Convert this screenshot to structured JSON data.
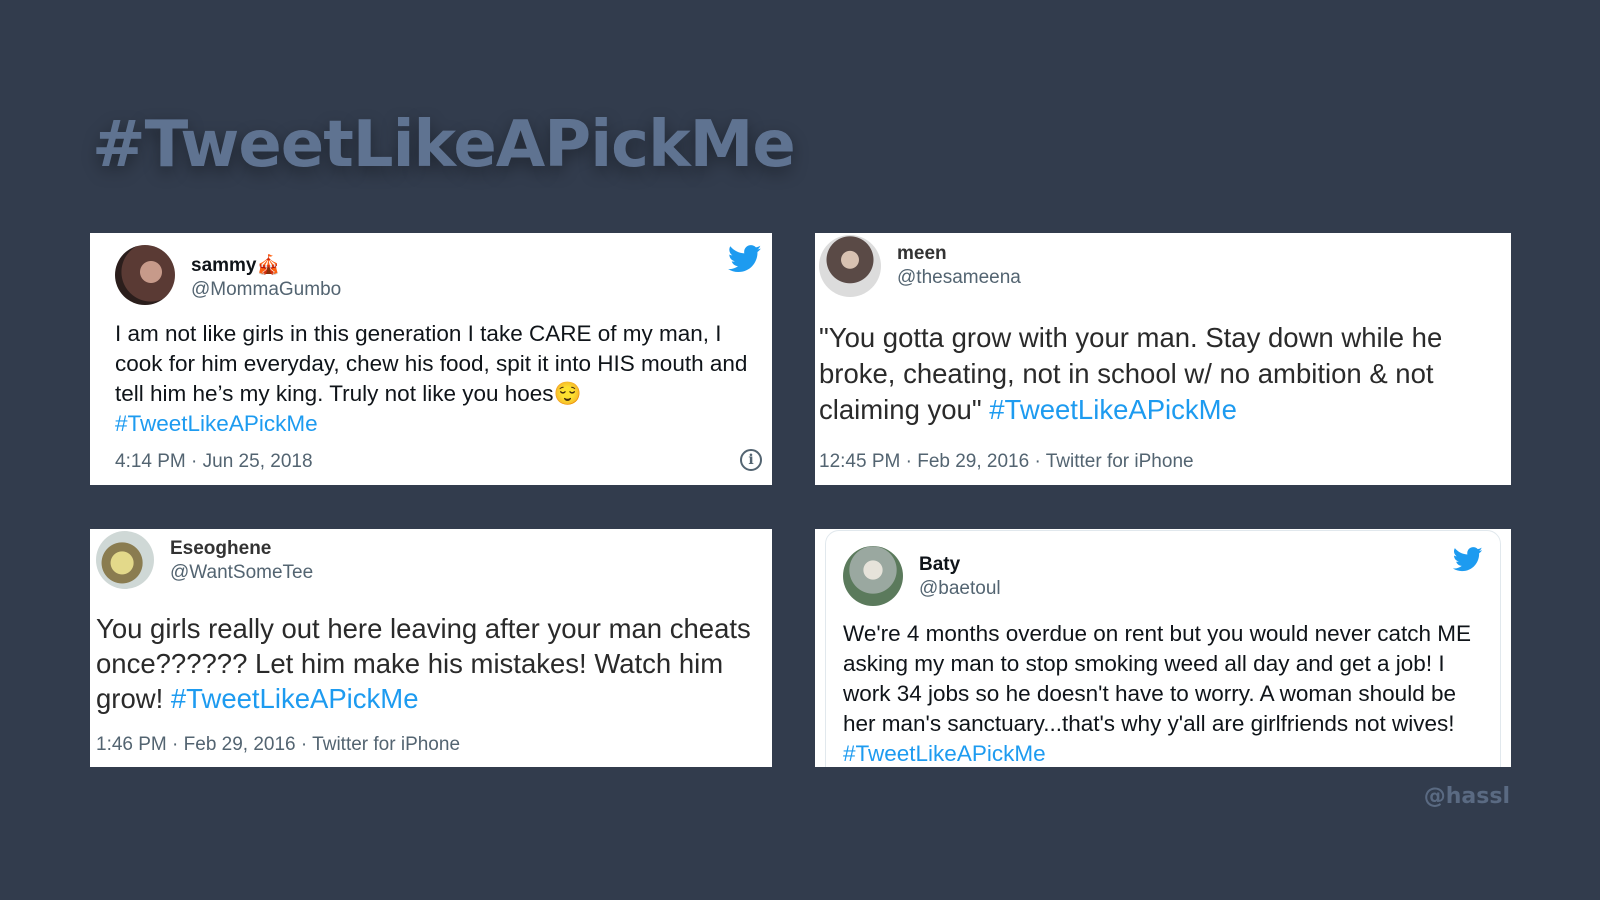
{
  "title": "#TweetLikeAPickMe",
  "watermark": "@hassl",
  "colors": {
    "background": "#323c4d",
    "title": "#5f7391",
    "hashtag": "#1d9bf0"
  },
  "tweets": [
    {
      "display_name": "sammy",
      "name_emoji": "🎪",
      "handle": "@MommaGumbo",
      "text": "I am not like girls in this generation I take CARE of my man, I cook for him everyday, chew his food, spit it into HIS mouth and tell him he’s my king. Truly not like you hoes😌",
      "hashtag": "#TweetLikeAPickMe",
      "meta": "4:14 PM · Jun 25, 2018",
      "icons": [
        "twitter-bird-icon",
        "info-icon"
      ]
    },
    {
      "display_name": "meen",
      "handle": "@thesameena",
      "text": "\"You gotta grow with your man. Stay down while he broke, cheating, not in school w/ no ambition & not claiming you\"",
      "hashtag": "#TweetLikeAPickMe",
      "meta": "12:45 PM · Feb 29, 2016 · Twitter for iPhone"
    },
    {
      "display_name": "Eseoghene",
      "handle": "@WantSomeTee",
      "text": "You girls really out here leaving after your man cheats once?????? Let him make his mistakes! Watch him grow!",
      "hashtag": "#TweetLikeAPickMe",
      "meta": "1:46 PM · Feb 29, 2016 · Twitter for iPhone"
    },
    {
      "display_name": "Baty",
      "handle": "@baetoul",
      "text": "We're 4 months overdue on rent but you would never catch ME asking my man to stop smoking weed all day and get a job! I work 34 jobs so he doesn't have to worry. A woman should be her man's sanctuary...that's why y'all are girlfriends not wives!",
      "hashtag": "#TweetLikeAPickMe",
      "icons": [
        "twitter-bird-icon"
      ]
    }
  ]
}
